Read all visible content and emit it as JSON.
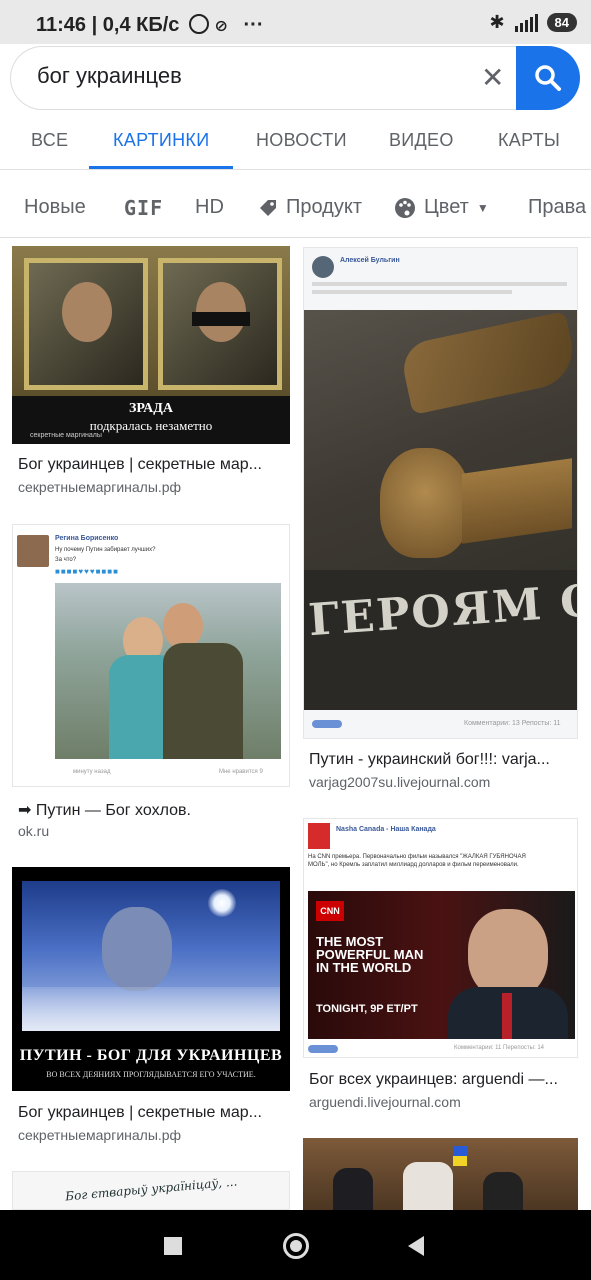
{
  "status_bar": {
    "time": "11:46",
    "speed": "0,4 КБ/с",
    "dots": "···",
    "battery": "84"
  },
  "search": {
    "query": "бог украинцев"
  },
  "tabs": [
    "ВСЕ",
    "КАРТИНКИ",
    "НОВОСТИ",
    "ВИДЕО",
    "КАРТЫ"
  ],
  "chips": {
    "new": "Новые",
    "gif": "GIF",
    "hd": "HD",
    "product": "Продукт",
    "color": "Цвет",
    "rights": "Права"
  },
  "results": [
    {
      "title": "Бог украинцев | секретные мар...",
      "domain": "секретныемаргиналы.рф",
      "caption1": "ЗРАДА",
      "caption2": "подкралась незаметно",
      "watermark": "секретные маргиналы"
    },
    {
      "title": "➡ Путин — Бог хохлов.",
      "domain": "ok.ru",
      "poster": "Регина Борисенко",
      "line1": "Ну почему Путин забирает лучших?",
      "line2": "За что?",
      "footer_left": "минуту назад",
      "footer_right": "Мне нравится 9"
    },
    {
      "title": "Бог украинцев | секретные мар...",
      "domain": "секретныемаргиналы.рф",
      "caption1": "ПУТИН - БОГ ДЛЯ УКРАИНЦЕВ",
      "caption2": "ВО ВСЕХ ДЕЯНИЯХ ПРОГЛЯДЫВАЕТСЯ ЕГО УЧАСТИЕ."
    },
    {
      "title": "Путин - украинский бог!!!: varja...",
      "domain": "varjag2007su.livejournal.com",
      "poster": "Алексей Бульгин",
      "plaque": "ГЕРОЯМ ОПАДО ЧИНУ",
      "footer": "Комментарии: 13  Репосты: 11"
    },
    {
      "title": "Бог всех украинцев: arguendi —...",
      "domain": "arguendi.livejournal.com",
      "poster": "Nasha Canada - Наша Канада",
      "post_text": "На CNN премьера. Первоначально фильм назывался \"ЖАЛКАЯ ГУБЯНОЧАЯ МОЛЬ\", но Кремль заплатил миллиард долларов и фильм переименовали.",
      "cnn_line1": "THE MOST",
      "cnn_line2": "POWERFUL MAN",
      "cnn_line3": "IN THE WORLD",
      "cnn_tonight": "TONIGHT, 9P ET/PT",
      "footer": "Комментарии: 11  Перепосты: 14"
    },
    {
      "caption": "Бог єтварыў україніцаў, ..."
    }
  ]
}
